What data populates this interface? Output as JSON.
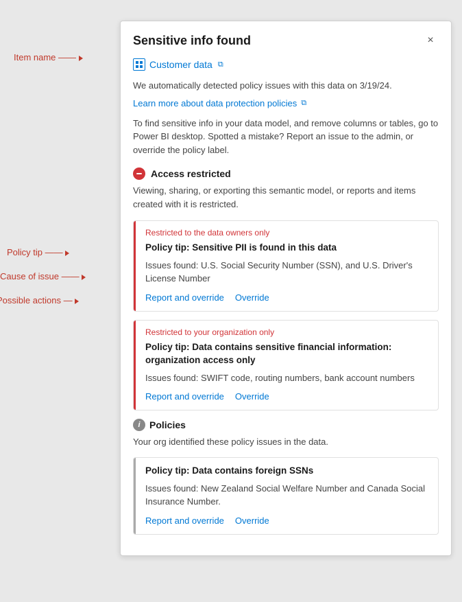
{
  "panel": {
    "title": "Sensitive info found",
    "close_label": "×",
    "item_name": "Customer data",
    "description": "We automatically detected policy issues with this data on 3/19/24.",
    "learn_more_text": "Learn more about data protection policies",
    "instruction": "To find sensitive info in your data model, and remove columns or tables, go to Power BI desktop. Spotted a mistake? Report an issue to the admin, or override the policy label.",
    "access_restricted_title": "Access restricted",
    "access_restricted_desc": "Viewing, sharing, or exporting this semantic model, or reports and items created with it is restricted.",
    "policy_cards": [
      {
        "restriction": "Restricted to the data owners only",
        "title": "Policy tip: Sensitive PII is found in this data",
        "issues": "Issues found: U.S. Social Security Number (SSN), and U.S. Driver's License Number",
        "action1": "Report and override",
        "action2": "Override"
      },
      {
        "restriction": "Restricted to your organization only",
        "title": "Policy tip: Data contains sensitive financial information: organization access only",
        "issues": "Issues found: SWIFT code, routing numbers, bank account numbers",
        "action1": "Report and override",
        "action2": "Override"
      }
    ],
    "policies_section": {
      "title": "Policies",
      "description": "Your org identified these policy issues in the data.",
      "card": {
        "title": "Policy tip: Data contains foreign SSNs",
        "issues": "Issues found: New Zealand Social Welfare Number and Canada Social Insurance Number.",
        "action1": "Report and override",
        "action2": "Override"
      }
    }
  },
  "annotations": {
    "item_name": "Item name",
    "policy_tip": "Policy tip",
    "cause_of_issue": "Cause of issue",
    "possible_actions": "Possible actions"
  }
}
